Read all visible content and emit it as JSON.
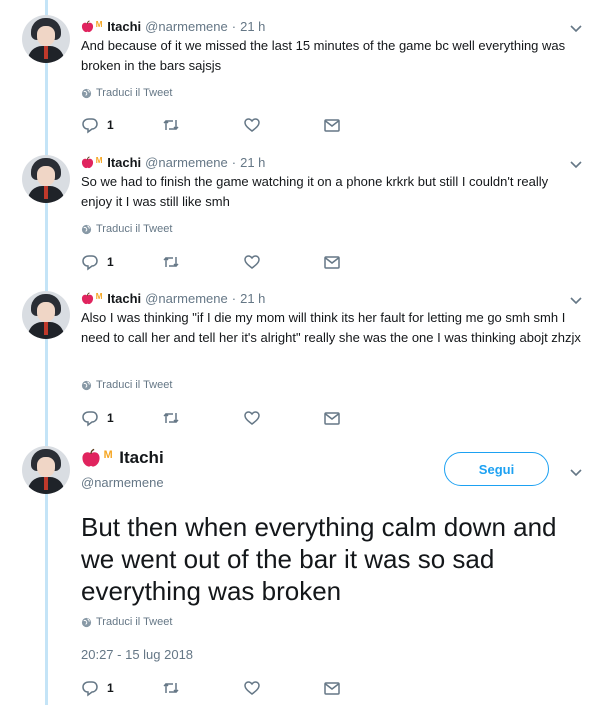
{
  "tweets": [
    {
      "name": "Itachi",
      "handle": "@narmemene",
      "dot": "·",
      "time": "21 h",
      "text": "And because of it we missed the last 15 minutes of the game bc well everything was broken in the bars sajsjs",
      "translate": "Traduci il Tweet",
      "reply_count": "1"
    },
    {
      "name": "Itachi",
      "handle": "@narmemene",
      "dot": "·",
      "time": "21 h",
      "text": "So we had to finish the game watching it on a phone krkrk but still I couldn't really enjoy it I was still like smh",
      "translate": "Traduci il Tweet",
      "reply_count": "1"
    },
    {
      "name": "Itachi",
      "handle": "@narmemene",
      "dot": "·",
      "time": "21 h",
      "text": "Also I was thinking \"if I die my mom will think its her fault for letting me go smh smh I need to call her and tell her it's alright\" really she was the one I was thinking abojt zhzjx",
      "translate": "Traduci il Tweet",
      "reply_count": "1"
    }
  ],
  "main_tweet": {
    "name": "Itachi",
    "handle": "@narmemene",
    "follow_label": "Segui",
    "text": "But then when everything calm down and we went out of the bar it was so sad everything was broken",
    "translate": "Traduci il Tweet",
    "timestamp": "20:27 - 15 lug 2018",
    "reply_count": "1"
  },
  "colors": {
    "accent": "#1da1f2",
    "thread_line": "#c4e4f7",
    "muted": "#657786",
    "emoji_m": "#f5a623",
    "apple": "#e0245e"
  },
  "icons": [
    "apple-emoji-icon",
    "m-emoji-icon",
    "chevron-down-icon",
    "globe-icon",
    "reply-icon",
    "retweet-icon",
    "like-icon",
    "message-icon"
  ]
}
